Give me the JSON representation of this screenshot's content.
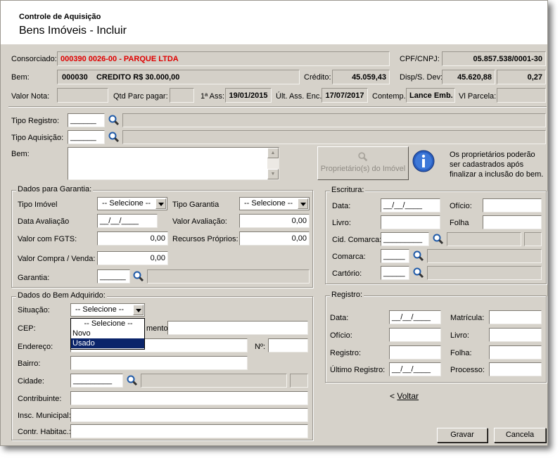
{
  "header": {
    "subtitle": "Controle de Aquisição",
    "title": "Bens Imóveis - Incluir"
  },
  "info": {
    "consorciado_label": "Consorciado:",
    "consorciado_value": "000390 0026-00 - PARQUE  LTDA",
    "cpf_label": "CPF/CNPJ:",
    "cpf_value": "05.857.538/0001-30",
    "bem_label": "Bem:",
    "bem_code": "000030",
    "bem_desc": "CREDITO R$  30.000,00",
    "credito_label": "Crédito:",
    "credito_value": "45.059,43",
    "disp_label": "Disp/S. Dev:",
    "disp_value": "45.620,88",
    "disp_value2": "0,27",
    "valor_nota_label": "Valor Nota:",
    "qtd_label": "Qtd Parc pagar:",
    "ass1_label": "1ª Ass:",
    "ass1_value": "19/01/2015",
    "ult_label": "Últ. Ass. Enc.:",
    "ult_value": "17/07/2017",
    "contemp_label": "Contemp.",
    "contemp_value": "Lance Emb.",
    "vl_parcela_label": "Vl Parcela:"
  },
  "registro": {
    "tipo_registro_label": "Tipo Registro:",
    "tipo_registro_value": "______",
    "tipo_aquisicao_label": "Tipo Aquisição:",
    "tipo_aquisicao_value": "______",
    "bem_label": "Bem:",
    "proprietarios_button": "Proprietário(s) do Imóvel",
    "info_text": [
      "Os proprietários poderão",
      "ser cadastrados após",
      "finalizar a inclusão do bem."
    ]
  },
  "garantia": {
    "title": "Dados para Garantia:",
    "tipo_imovel_label": "Tipo Imóvel",
    "tipo_imovel_value": "-- Selecione --",
    "tipo_garantia_label": "Tipo Garantia",
    "tipo_garantia_value": "-- Selecione --",
    "data_avaliacao_label": "Data Avaliação",
    "data_avaliacao_value": "__/__/____",
    "valor_avaliacao_label": "Valor Avaliação:",
    "valor_avaliacao_value": "0,00",
    "valor_fgts_label": "Valor com FGTS:",
    "valor_fgts_value": "0,00",
    "recursos_label": "Recursos Próprios:",
    "recursos_value": "0,00",
    "valor_compra_label": "Valor Compra / Venda:",
    "valor_compra_value": "0,00",
    "garantia_label": "Garantia:",
    "garantia_value": "______"
  },
  "escritura": {
    "title": "Escritura:",
    "data_label": "Data:",
    "data_value": "__/__/____",
    "oficio_label": "Ofício:",
    "livro_label": "Livro:",
    "folha_label": "Folha",
    "cid_comarca_label": "Cid. Comarca:",
    "cid_comarca_value": "_________",
    "comarca_label": "Comarca:",
    "comarca_value": "_____",
    "cartorio_label": "Cartório:",
    "cartorio_value": "_____"
  },
  "bem_adquirido": {
    "title": "Dados do Bem Adquirido:",
    "situacao_label": "Situação:",
    "situacao_value": "-- Selecione --",
    "situacao_options": [
      "-- Selecione --",
      "Novo",
      "Usado"
    ],
    "cep_label": "CEP:",
    "complemento_label": "mento:",
    "endereco_label": "Endereço:",
    "numero_label": "Nº:",
    "bairro_label": "Bairro:",
    "cidade_label": "Cidade:",
    "cidade_value": "_________",
    "contribuinte_label": "Contribuinte:",
    "insc_municipal_label": "Insc. Municipal:",
    "contr_habitac_label": "Contr. Habitac.:"
  },
  "registro_box": {
    "title": "Registro:",
    "data_label": "Data:",
    "data_value": "__/__/____",
    "matricula_label": "Matrícula:",
    "oficio_label": "Ofício:",
    "livro_label": "Livro:",
    "registro_label": "Registro:",
    "folha_label": "Folha:",
    "ultimo_label": "Último Registro:",
    "ultimo_value": "__/__/____",
    "processo_label": "Processo:"
  },
  "actions": {
    "voltar": "Voltar",
    "voltar_prefix": "<",
    "gravar": "Gravar",
    "cancela": "Cancela"
  },
  "colors": {
    "red_text": "#e00000",
    "panel": "#d6d2ca",
    "highlight": "#0a246a"
  }
}
